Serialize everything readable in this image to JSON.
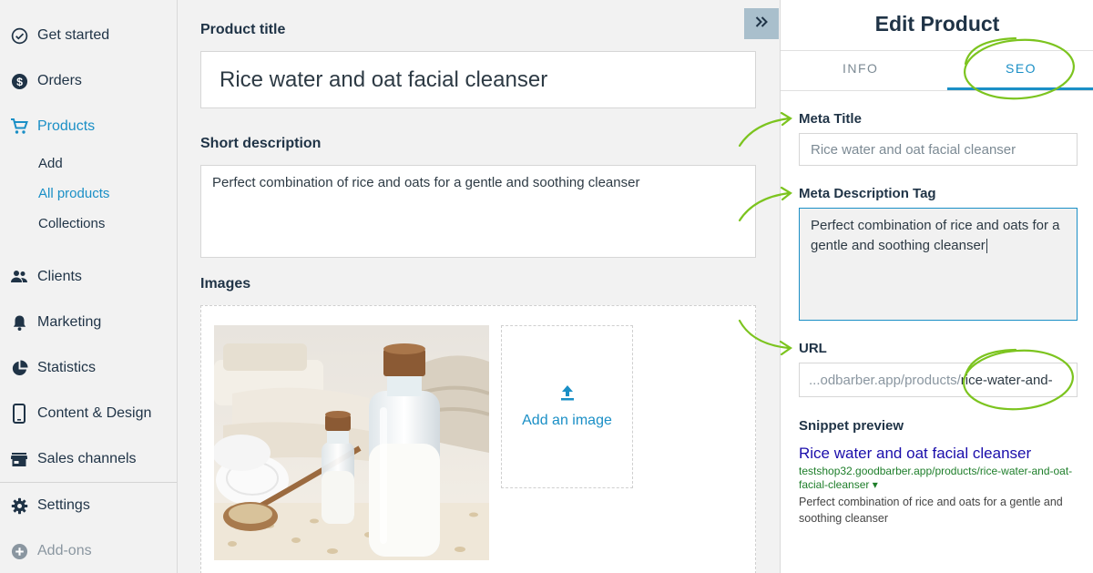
{
  "sidebar": {
    "items": [
      {
        "label": "Get started",
        "icon": "check-circle-icon"
      },
      {
        "label": "Orders",
        "icon": "dollar-circle-icon"
      },
      {
        "label": "Products",
        "icon": "cart-icon"
      },
      {
        "label": "Clients",
        "icon": "people-icon"
      },
      {
        "label": "Marketing",
        "icon": "bell-icon"
      },
      {
        "label": "Statistics",
        "icon": "pie-chart-icon"
      },
      {
        "label": "Content & Design",
        "icon": "phone-icon"
      },
      {
        "label": "Sales channels",
        "icon": "store-icon"
      },
      {
        "label": "Settings",
        "icon": "gear-icon"
      },
      {
        "label": "Add-ons",
        "icon": "plus-circle-icon"
      }
    ],
    "sub_items": [
      "Add",
      "All products",
      "Collections"
    ],
    "active_item": "Products",
    "active_sub_item": "All products"
  },
  "main": {
    "title_label": "Product title",
    "title_value": "Rice water and oat facial cleanser",
    "desc_label": "Short description",
    "desc_value": "Perfect combination of rice and oats for a gentle and soothing cleanser",
    "images_label": "Images",
    "add_image": "Add an image",
    "expand_icon": "double-chevron-right-icon"
  },
  "panel": {
    "title": "Edit Product",
    "tabs": [
      "INFO",
      "SEO"
    ],
    "active_tab": "SEO",
    "meta_title_label": "Meta Title",
    "meta_title_placeholder": "Rice water and oat facial cleanser",
    "meta_desc_label": "Meta Description Tag",
    "meta_desc_value": "Perfect combination of rice and oats for a gentle and soothing cleanser",
    "url_label": "URL",
    "url_prefix": "...odbarber.app/products/",
    "url_slug": "rice-water-and-",
    "snippet_label": "Snippet preview",
    "snippet_title": "Rice water and oat facial cleanser",
    "snippet_url": "testshop32.goodbarber.app/products/rice-water-and-oat-facial-cleanser ▾",
    "snippet_desc": "Perfect combination of rice and oats for a gentle and soothing cleanser"
  },
  "colors": {
    "accent": "#1a8fc6",
    "text_dark": "#1f3346",
    "annotation": "#7cc41f"
  }
}
